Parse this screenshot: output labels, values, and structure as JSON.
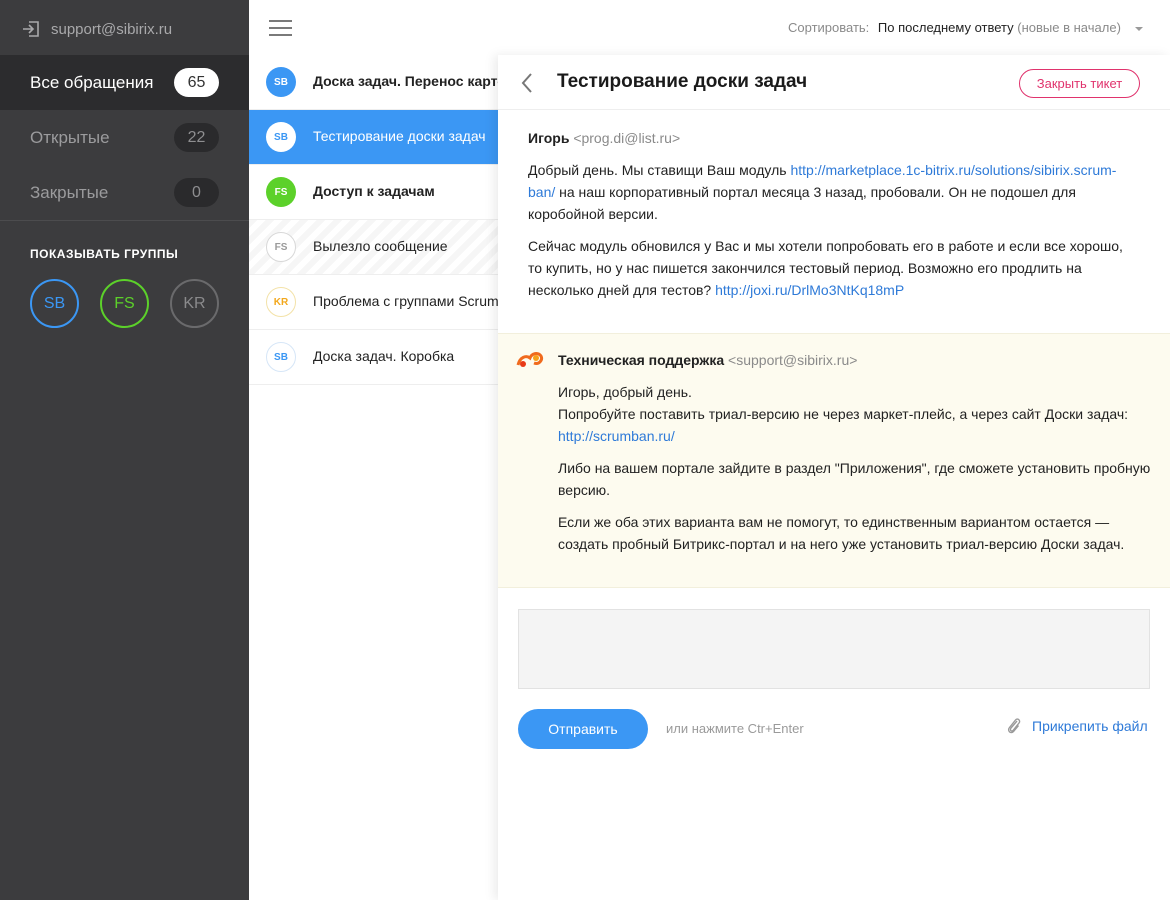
{
  "sidebar": {
    "account_email": "support@sibirix.ru",
    "nav": [
      {
        "label": "Все обращения",
        "count": "65"
      },
      {
        "label": "Открытые",
        "count": "22"
      },
      {
        "label": "Закрытые",
        "count": "0"
      }
    ],
    "groups_title": "ПОКАЗЫВАТЬ ГРУППЫ",
    "groups": [
      {
        "label": "SB",
        "color": "#3b97f4"
      },
      {
        "label": "FS",
        "color": "#5cd12a"
      },
      {
        "label": "KR",
        "color": "#6a6a6c"
      }
    ]
  },
  "sort": {
    "label": "Сортировать:",
    "value": "По последнему ответу",
    "hint": "(новые в начале)"
  },
  "tickets": [
    {
      "avatar": "SB",
      "subject": "Доска задач. Перенос карточек"
    },
    {
      "avatar": "SB",
      "subject": "Тестирование доски задач"
    },
    {
      "avatar": "FS",
      "subject": "Доступ к задачам"
    },
    {
      "avatar": "FS",
      "subject": "Вылезло сообщение"
    },
    {
      "avatar": "KR",
      "subject": "Проблема с группами Scrum"
    },
    {
      "avatar": "SB",
      "subject": "Доска задач. Коробка"
    }
  ],
  "detail": {
    "title": "Тестирование доски задач",
    "close_label": "Закрыть тикет",
    "message1": {
      "author": "Игорь",
      "email": "<prog.di@list.ru>",
      "p1_text_a": "Добрый день. Мы ставищи Ваш модуль ",
      "p1_link": "http://marketplace.1c-bitrix.ru/solutions/sibirix.scrum-ban/",
      "p1_text_b": " на наш корпоративный портал месяца 3 назад, пробовали. Он не подошел для коробойной версии.",
      "p2_text": "Сейчас модуль обновился у Вас и мы хотели попробовать его в работе и если все хорошо, то купить, но у нас пишется закончился тестовый период. Возможно его продлить на несколько дней для тестов? ",
      "p2_link": "http://joxi.ru/DrlMo3NtKq18mP"
    },
    "message2": {
      "author": "Техническая поддержка",
      "email": "<support@sibirix.ru>",
      "p1_line1": "Игорь, добрый день.",
      "p1_line2": "Попробуйте поставить триал-версию не через маркет-плейс, а через сайт Доски задач: ",
      "p1_link": "http://scrumban.ru/",
      "p2_text": "Либо на вашем портале зайдите в раздел \"Приложения\", где сможете установить пробную версию.",
      "p3_text": "Если же оба этих варианта вам не помогут, то единственным вариантом остается — создать пробный Битрикс-портал и на него уже установить триал-версию Доски задач."
    },
    "reply": {
      "placeholder": "",
      "send_label": "Отправить",
      "send_hint": "или нажмите Ctr+Enter",
      "attach_label": "Прикрепить файл"
    }
  }
}
